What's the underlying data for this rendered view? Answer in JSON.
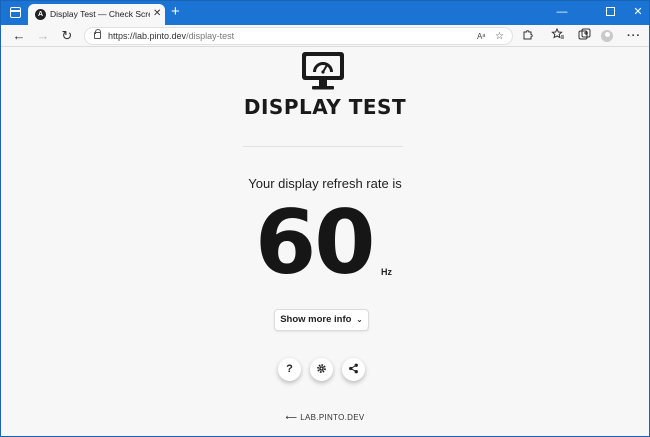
{
  "browser": {
    "tab": {
      "title": "Display Test — Check Screen Refresh Rate",
      "favicon_letter": "A",
      "close_glyph": "✕"
    },
    "new_tab_glyph": "+",
    "window_controls": {
      "minimize": "—",
      "close": "✕"
    },
    "nav": {
      "back": "←",
      "forward": "→",
      "reload": "↻"
    },
    "address": {
      "host": "https://lab.pinto.dev",
      "path": "/display-test"
    },
    "toolbar_icons": [
      "read-aloud-icon",
      "favorites-add-icon",
      "extensions-icon",
      "favorites-icon",
      "collections-icon",
      "profile-icon",
      "more-icon"
    ],
    "read_aloud_glyph": "Aᵃ",
    "favorite_glyph": "☆",
    "more_glyph": "···"
  },
  "page": {
    "title": "DISPLAY TEST",
    "subtitle": "Your display refresh rate is",
    "refresh_rate": "60",
    "unit": "Hz",
    "more_button": {
      "label": "Show more info",
      "chevron": "⌄"
    },
    "actions": {
      "help": "?",
      "settings": "⚙",
      "share": "⑂"
    },
    "footer_link": {
      "arrow": "⟵",
      "label": "LAB.PINTO.DEV"
    }
  },
  "colors": {
    "titlebar": "#1b73d3",
    "page_bg": "#f7f7f7",
    "text_dark": "#161616"
  }
}
